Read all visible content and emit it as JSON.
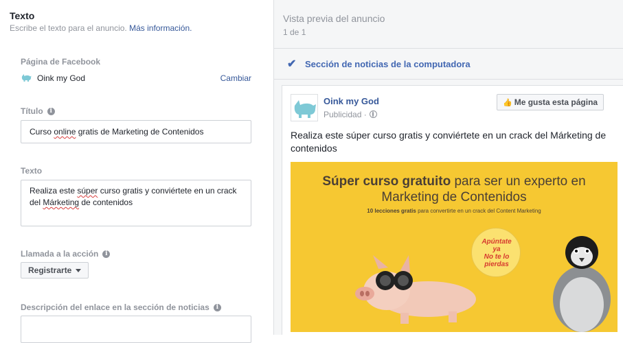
{
  "editor": {
    "section_title": "Texto",
    "section_subtitle": "Escribe el texto para el anuncio.",
    "more_info_link": "Más información.",
    "facebook_page": {
      "label": "Página de Facebook",
      "page_name": "Oink my God",
      "change_label": "Cambiar"
    },
    "title_field": {
      "label": "Título",
      "value_pre": "Curso ",
      "value_misspelled": "online",
      "value_post": " gratis de Marketing de Contenidos"
    },
    "text_field": {
      "label": "Texto",
      "line1_pre": "Realiza este ",
      "line1_misspelled": "súper",
      "line1_post": " curso gratis y conviértete en un crack",
      "line2_pre": "del ",
      "line2_misspelled": "Márketing",
      "line2_post": " de contenidos"
    },
    "cta": {
      "label": "Llamada a la acción",
      "selected": "Registrarte"
    },
    "link_description": {
      "label": "Descripción del enlace en la sección de noticias"
    }
  },
  "preview": {
    "title": "Vista previa del anuncio",
    "count": "1 de 1",
    "placement": "Sección de noticias de la computadora",
    "accent_color": "#4267b2",
    "post": {
      "page_name": "Oink my God",
      "sponsored": "Publicidad ·",
      "like_button": "Me gusta esta página",
      "body": "Realiza este súper curso gratis y conviértete en un crack del Márketing de contenidos",
      "creative": {
        "headline_bold": "Súper curso gratuito",
        "headline_rest": "para ser un experto en",
        "headline_line2": "Marketing de Contenidos",
        "sub_bold": "10 lecciones gratis",
        "sub_rest": "para convertirte en un crack del Content Marketing",
        "bubble_line1": "Apúntate",
        "bubble_line2": "ya",
        "bubble_line3": "No te lo",
        "bubble_line4": "pierdas",
        "background_color": "#f6c832"
      }
    }
  }
}
